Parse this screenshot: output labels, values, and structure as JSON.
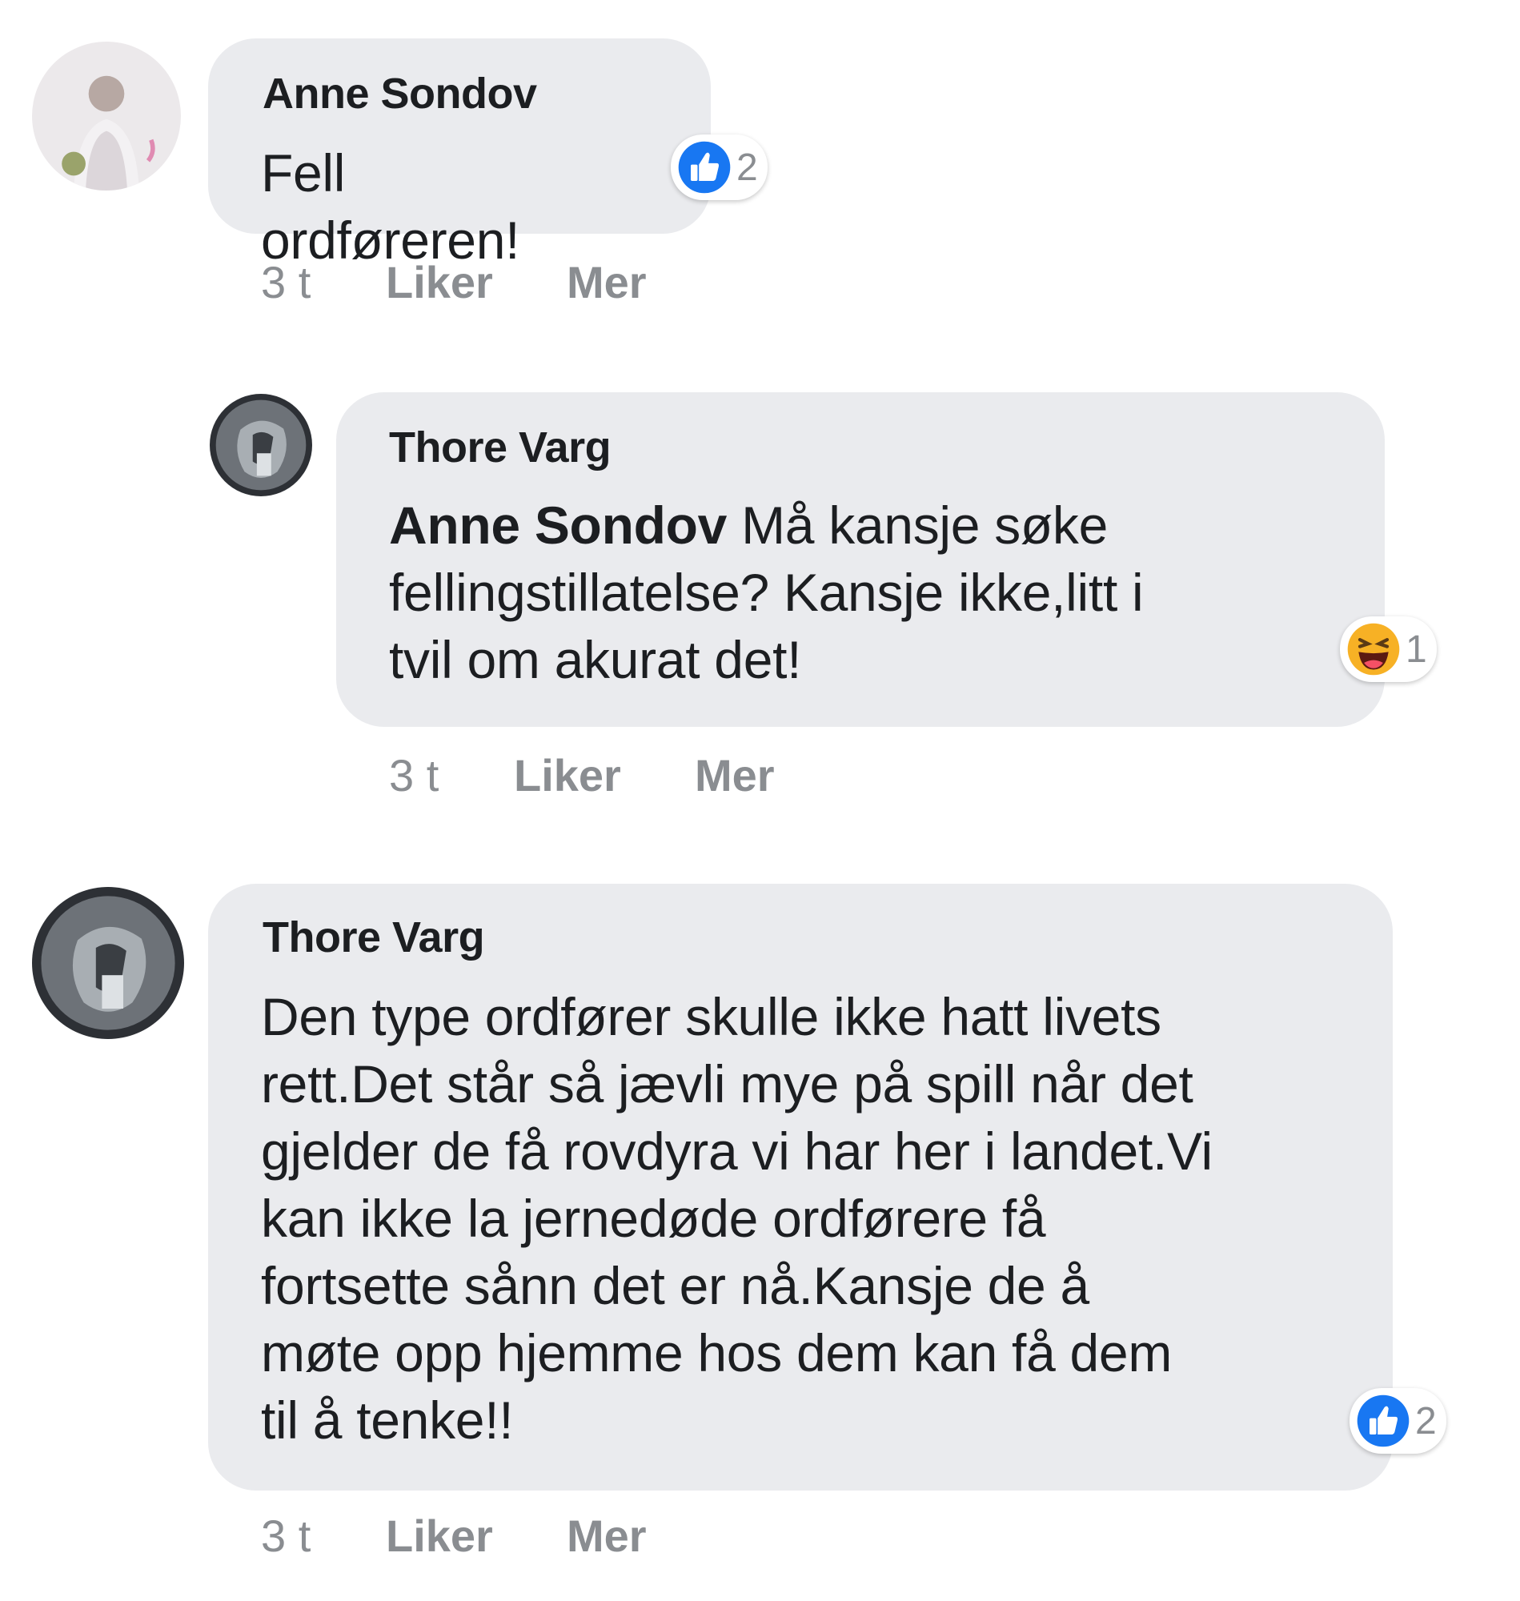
{
  "comments": [
    {
      "author": "Anne Sondov",
      "mention": "",
      "text": "Fell ordføreren!",
      "reaction": {
        "icon": "like-icon",
        "count": "2"
      },
      "time": "3 t",
      "like_label": "Liker",
      "more_label": "Mer"
    },
    {
      "author": "Thore Varg",
      "mention": "Anne Sondov",
      "text_line1": " Må kansje søke",
      "text_line2": "fellingstillatelse? Kansje ikke,litt i",
      "text_line3": "tvil om akurat det!",
      "reaction": {
        "icon": "haha-icon",
        "count": "1"
      },
      "time": "3 t",
      "like_label": "Liker",
      "more_label": "Mer"
    },
    {
      "author": "Thore Varg",
      "lines": [
        "Den type ordfører skulle ikke hatt livets",
        "rett.Det står så jævli mye på spill når det",
        "gjelder de få rovdyra vi har her i landet.Vi",
        "kan ikke la jernedøde ordførere få",
        "fortsette sånn det er nå.Kansje de å",
        "møte opp hjemme hos dem kan få dem",
        "til å tenke!!"
      ],
      "reaction": {
        "icon": "like-icon",
        "count": "2"
      },
      "time": "3 t",
      "like_label": "Liker",
      "more_label": "Mer"
    }
  ],
  "colors": {
    "bubble": "#eaebee",
    "meta": "#8a8d91",
    "like_blue": "#1877f2",
    "haha_yellow": "#f7b125"
  }
}
